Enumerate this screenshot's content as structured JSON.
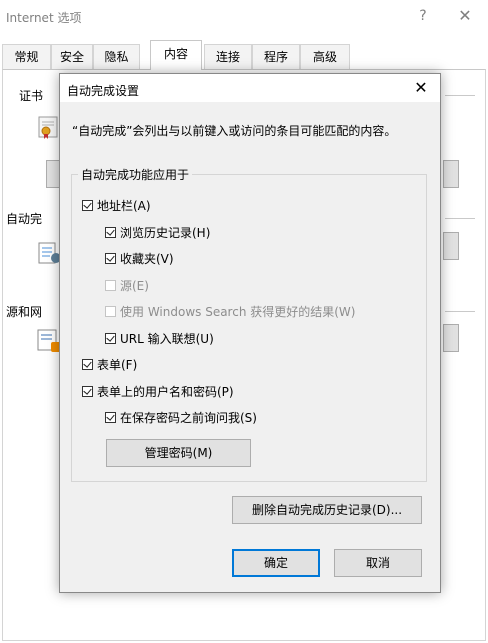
{
  "window": {
    "title": "Internet 选项",
    "help": "?",
    "close": "✕"
  },
  "tabs": [
    "常规",
    "安全",
    "隐私",
    "内容",
    "连接",
    "程序",
    "高级"
  ],
  "active_tab": "内容",
  "panel": {
    "cert_label": "证书",
    "autocomplete_label": "自动完",
    "feeds_label": "源和网"
  },
  "dialog": {
    "title": "自动完成设置",
    "close": "✕",
    "description": "“自动完成”会列出与以前键入或访问的条目可能匹配的内容。",
    "group_title": "自动完成功能应用于",
    "options": [
      {
        "label": "地址栏(A)",
        "checked": true,
        "enabled": true
      },
      {
        "label": "浏览历史记录(H)",
        "checked": true,
        "enabled": true
      },
      {
        "label": "收藏夹(V)",
        "checked": true,
        "enabled": true
      },
      {
        "label": "源(E)",
        "checked": false,
        "enabled": false
      },
      {
        "label": "使用 Windows Search 获得更好的结果(W)",
        "checked": false,
        "enabled": false
      },
      {
        "label": "URL 输入联想(U)",
        "checked": true,
        "enabled": true
      },
      {
        "label": "表单(F)",
        "checked": true,
        "enabled": true
      },
      {
        "label": "表单上的用户名和密码(P)",
        "checked": true,
        "enabled": true
      },
      {
        "label": "在保存密码之前询问我(S)",
        "checked": true,
        "enabled": true
      }
    ],
    "manage_passwords": "管理密码(M)",
    "delete_history": "删除自动完成历史记录(D)...",
    "ok": "确定",
    "cancel": "取消"
  }
}
